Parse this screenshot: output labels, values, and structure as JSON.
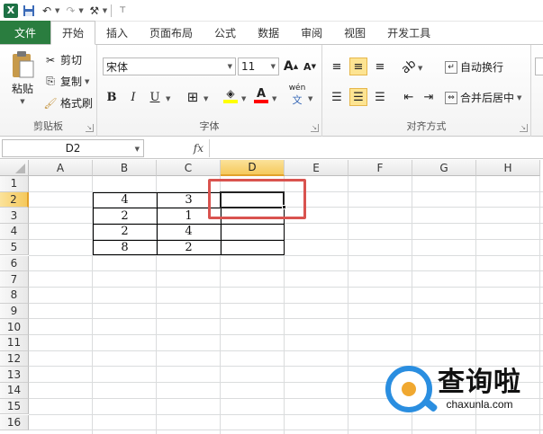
{
  "qat": {
    "app_icon": "X",
    "icons": [
      "save-icon",
      "undo-icon",
      "redo-icon",
      "tools-icon",
      "customize-icon"
    ]
  },
  "tabs": [
    {
      "label": "文件",
      "kind": "file"
    },
    {
      "label": "开始",
      "kind": "active"
    },
    {
      "label": "插入"
    },
    {
      "label": "页面布局"
    },
    {
      "label": "公式"
    },
    {
      "label": "数据"
    },
    {
      "label": "审阅"
    },
    {
      "label": "视图"
    },
    {
      "label": "开发工具"
    }
  ],
  "clipboard": {
    "paste_label": "粘贴",
    "cut_label": "剪切",
    "copy_label": "复制",
    "format_painter_label": "格式刷",
    "group_label": "剪贴板"
  },
  "font": {
    "name": "宋体",
    "size": "11",
    "bold": "B",
    "italic": "I",
    "underline": "U",
    "grow": "A",
    "shrink": "A",
    "font_color": "A",
    "fill_color": "#ffff00",
    "text_color": "#ff0000",
    "group_label": "字体",
    "phonetic": "wén"
  },
  "alignment": {
    "wrap_text_label": "自动换行",
    "merge_label": "合并后居中",
    "group_label": "对齐方式"
  },
  "formula_bar": {
    "name_box": "D2",
    "fx": "fx",
    "value": ""
  },
  "sheet": {
    "columns": [
      "A",
      "B",
      "C",
      "D",
      "E",
      "F",
      "G",
      "H"
    ],
    "rows": [
      "1",
      "2",
      "3",
      "4",
      "5",
      "6",
      "7",
      "8",
      "9",
      "10",
      "11",
      "12",
      "13",
      "14",
      "15",
      "16"
    ],
    "selected_cell": "D2",
    "cells": [
      {
        "ref": "B2",
        "value": "4"
      },
      {
        "ref": "C2",
        "value": "3"
      },
      {
        "ref": "B3",
        "value": "2"
      },
      {
        "ref": "C3",
        "value": "1"
      },
      {
        "ref": "B4",
        "value": "2"
      },
      {
        "ref": "C4",
        "value": "4"
      },
      {
        "ref": "B5",
        "value": "8"
      },
      {
        "ref": "C5",
        "value": "2"
      }
    ]
  },
  "watermark": {
    "brand_cn": "查询啦",
    "brand_en": "chaxunla.com"
  },
  "colors": {
    "accent_file_tab": "#2a7d3f",
    "selection_header": "#f5c95c",
    "highlight_box": "#d9534f"
  }
}
